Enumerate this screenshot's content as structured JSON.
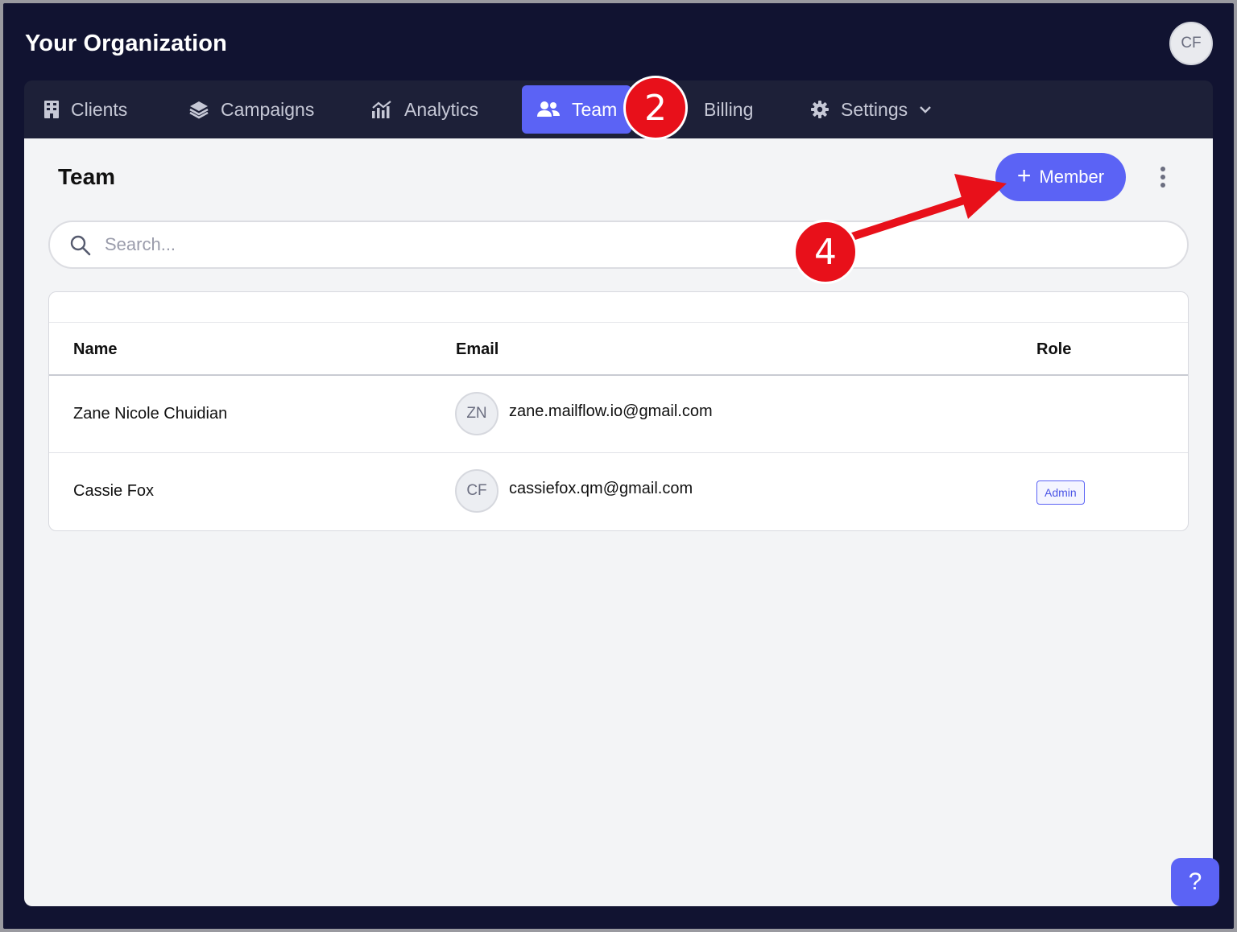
{
  "app": {
    "org_title": "Your Organization",
    "user_initials": "CF"
  },
  "nav": {
    "items": [
      {
        "label": "Clients",
        "icon": "building-icon"
      },
      {
        "label": "Campaigns",
        "icon": "layers-icon"
      },
      {
        "label": "Analytics",
        "icon": "chart-icon"
      },
      {
        "label": "Team",
        "icon": "users-icon",
        "active": true
      },
      {
        "label": "Billing",
        "icon": "none"
      },
      {
        "label": "Settings",
        "icon": "gear-icon",
        "has_dropdown": true
      }
    ]
  },
  "page": {
    "title": "Team",
    "add_member_label": "Member",
    "search_placeholder": "Search..."
  },
  "table": {
    "columns": [
      "Name",
      "Email",
      "Role"
    ],
    "rows": [
      {
        "name": "Zane Nicole Chuidian",
        "initials": "ZN",
        "email": "zane.mailflow.io@gmail.com",
        "role": ""
      },
      {
        "name": "Cassie Fox",
        "initials": "CF",
        "email": "cassiefox.qm@gmail.com",
        "role": "Admin"
      }
    ]
  },
  "help": {
    "label": "?"
  },
  "annotations": {
    "step_a": "2",
    "step_b": "4",
    "color": "#e8101a"
  },
  "colors": {
    "accent": "#5b63f5",
    "background": "#111331"
  }
}
